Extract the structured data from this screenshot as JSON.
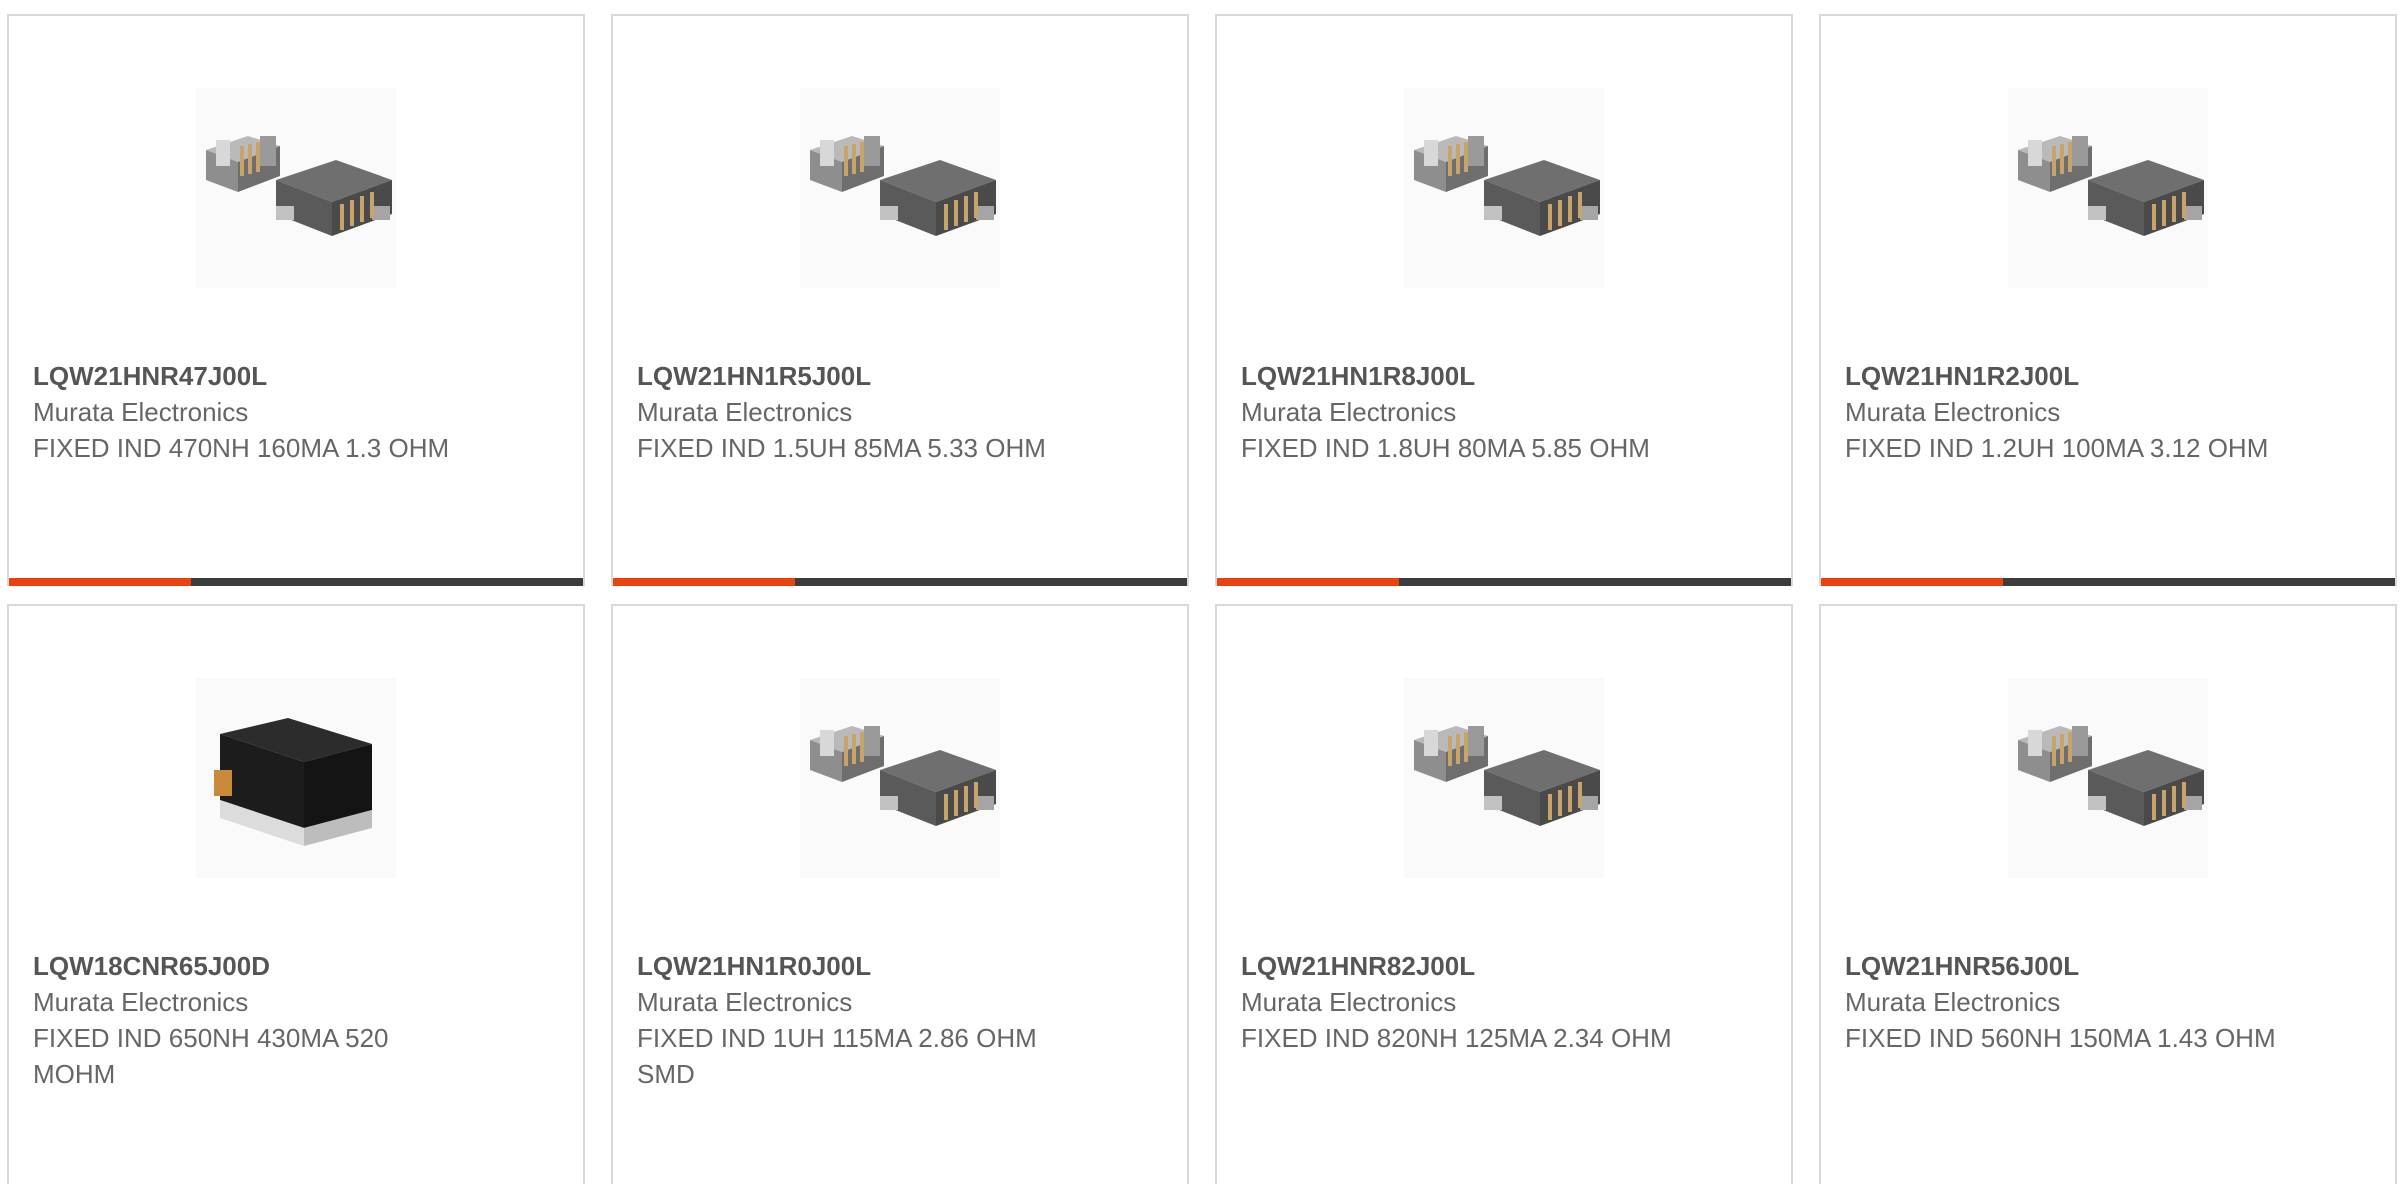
{
  "products": [
    {
      "part_number": "LQW21HNR47J00L",
      "manufacturer": "Murata Electronics",
      "description": "FIXED IND 470NH 160MA 1.3 OHM",
      "image_icon": "wirewound-inductor-pair-icon"
    },
    {
      "part_number": "LQW21HN1R5J00L",
      "manufacturer": "Murata Electronics",
      "description": "FIXED IND 1.5UH 85MA 5.33 OHM",
      "image_icon": "wirewound-inductor-pair-icon"
    },
    {
      "part_number": "LQW21HN1R8J00L",
      "manufacturer": "Murata Electronics",
      "description": "FIXED IND 1.8UH 80MA 5.85 OHM",
      "image_icon": "wirewound-inductor-pair-icon"
    },
    {
      "part_number": "LQW21HN1R2J00L",
      "manufacturer": "Murata Electronics",
      "description": "FIXED IND 1.2UH 100MA 3.12 OHM",
      "image_icon": "wirewound-inductor-pair-icon"
    },
    {
      "part_number": "LQW18CNR65J00D",
      "manufacturer": "Murata Electronics",
      "description": "FIXED IND 650NH 430MA 520 MOHM",
      "image_icon": "black-chip-inductor-icon"
    },
    {
      "part_number": "LQW21HN1R0J00L",
      "manufacturer": "Murata Electronics",
      "description": "FIXED IND 1UH 115MA 2.86 OHM SMD",
      "image_icon": "wirewound-inductor-pair-icon"
    },
    {
      "part_number": "LQW21HNR82J00L",
      "manufacturer": "Murata Electronics",
      "description": "FIXED IND 820NH 125MA 2.34 OHM",
      "image_icon": "wirewound-inductor-pair-icon"
    },
    {
      "part_number": "LQW21HNR56J00L",
      "manufacturer": "Murata Electronics",
      "description": "FIXED IND 560NH 150MA 1.43 OHM",
      "image_icon": "wirewound-inductor-pair-icon"
    }
  ],
  "colors": {
    "accent": "#e8420f",
    "bar": "#3c3c3c",
    "border": "#d9d9d9",
    "text": "#666666"
  }
}
